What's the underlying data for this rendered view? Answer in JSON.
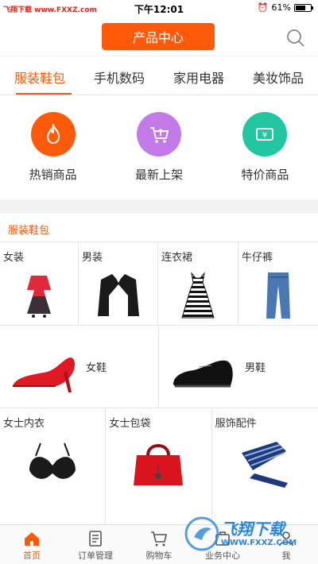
{
  "status_bar": {
    "watermark": "飞翔下载 www.FXXZ.com",
    "time": "下午12:01",
    "battery": "61%"
  },
  "header": {
    "title": "产品中心",
    "search_icon": "search-icon"
  },
  "tabs": [
    {
      "label": "服装鞋包",
      "active": true
    },
    {
      "label": "手机数码",
      "active": false
    },
    {
      "label": "家用电器",
      "active": false
    },
    {
      "label": "美妆饰品",
      "active": false
    }
  ],
  "quick_links": [
    {
      "label": "热销商品",
      "icon": "flame-icon",
      "color": "#ff5a0a"
    },
    {
      "label": "最新上架",
      "icon": "cart-upload-icon",
      "color": "#c27ae8"
    },
    {
      "label": "特价商品",
      "icon": "yuan-ticket-icon",
      "color": "#22c6a0"
    }
  ],
  "section": {
    "title": "服装鞋包"
  },
  "categories": {
    "row1": [
      {
        "label": "女装",
        "image": "dress-outfit-image"
      },
      {
        "label": "男装",
        "image": "suit-jacket-image"
      },
      {
        "label": "连衣裙",
        "image": "striped-dress-image"
      },
      {
        "label": "牛仔裤",
        "image": "jeans-image"
      }
    ],
    "row2": [
      {
        "label": "女鞋",
        "image": "red-heel-image"
      },
      {
        "label": "男鞋",
        "image": "mens-shoe-image"
      }
    ],
    "row3": [
      {
        "label": "女士内衣",
        "image": "bra-image"
      },
      {
        "label": "女士包袋",
        "image": "handbag-image"
      },
      {
        "label": "服饰配件",
        "image": "tie-image"
      }
    ]
  },
  "bottom_nav": [
    {
      "label": "首页",
      "icon": "home-icon",
      "active": true
    },
    {
      "label": "订单管理",
      "icon": "order-icon",
      "active": false
    },
    {
      "label": "购物车",
      "icon": "cart-icon",
      "active": false
    },
    {
      "label": "业务中心",
      "icon": "business-icon",
      "active": false
    },
    {
      "label": "我",
      "icon": "user-icon",
      "active": false
    }
  ],
  "watermark_logo": {
    "text": "飞翔下载",
    "url": "WWW.FXXZ.COM"
  },
  "colors": {
    "accent": "#ff5a0a",
    "purple": "#c27ae8",
    "teal": "#22c6a0"
  }
}
